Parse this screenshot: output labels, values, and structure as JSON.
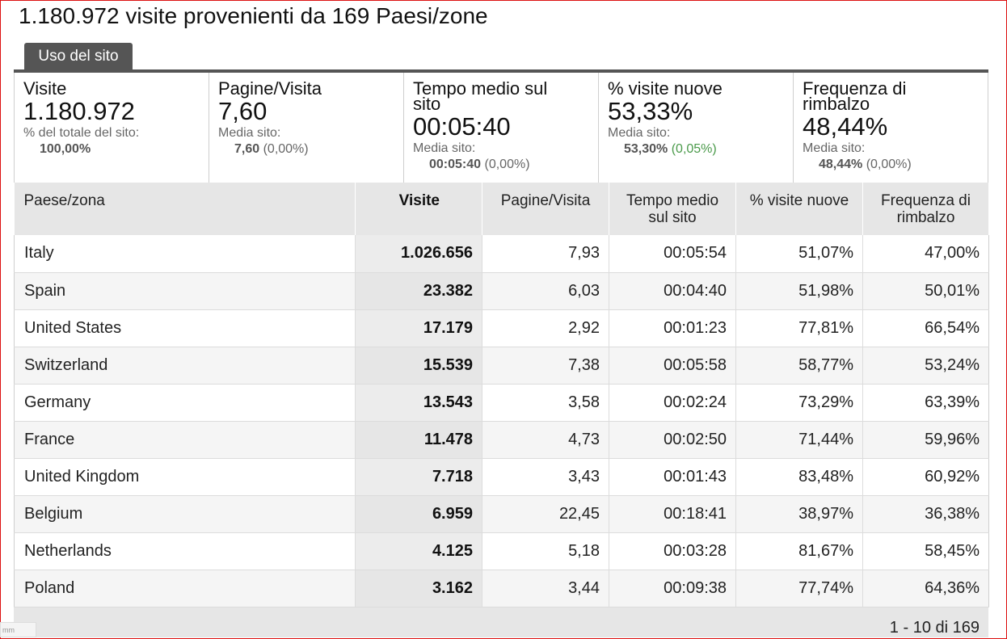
{
  "title": "1.180.972 visite provenienti da 169 Paesi/zone",
  "tab": "Uso del sito",
  "summary": [
    {
      "label": "Visite",
      "value": "1.180.972",
      "sub_label": "% del totale del sito:",
      "sub_value_bold": "100,00%",
      "sub_value_extra": ""
    },
    {
      "label": "Pagine/Visita",
      "value": "7,60",
      "sub_label": "Media sito:",
      "sub_value_bold": "7,60",
      "sub_value_extra": " (0,00%)"
    },
    {
      "label": "Tempo medio sul sito",
      "value": "00:05:40",
      "sub_label": "Media sito:",
      "sub_value_bold": "00:05:40",
      "sub_value_extra": " (0,00%)"
    },
    {
      "label": "% visite nuove",
      "value": "53,33%",
      "sub_label": "Media sito:",
      "sub_value_bold": "53,30%",
      "sub_value_extra": " (0,05%)"
    },
    {
      "label": "Frequenza di rimbalzo",
      "value": "48,44%",
      "sub_label": "Media sito:",
      "sub_value_bold": "48,44%",
      "sub_value_extra": " (0,00%)"
    }
  ],
  "table": {
    "headers": [
      "Paese/zona",
      "Visite",
      "Pagine/Visita",
      "Tempo medio sul sito",
      "% visite nuove",
      "Frequenza di rimbalzo"
    ],
    "rows": [
      [
        "Italy",
        "1.026.656",
        "7,93",
        "00:05:54",
        "51,07%",
        "47,00%"
      ],
      [
        "Spain",
        "23.382",
        "6,03",
        "00:04:40",
        "51,98%",
        "50,01%"
      ],
      [
        "United States",
        "17.179",
        "2,92",
        "00:01:23",
        "77,81%",
        "66,54%"
      ],
      [
        "Switzerland",
        "15.539",
        "7,38",
        "00:05:58",
        "58,77%",
        "53,24%"
      ],
      [
        "Germany",
        "13.543",
        "3,58",
        "00:02:24",
        "73,29%",
        "63,39%"
      ],
      [
        "France",
        "11.478",
        "4,73",
        "00:02:50",
        "71,44%",
        "59,96%"
      ],
      [
        "United Kingdom",
        "7.718",
        "3,43",
        "00:01:43",
        "83,48%",
        "60,92%"
      ],
      [
        "Belgium",
        "6.959",
        "22,45",
        "00:18:41",
        "38,97%",
        "36,38%"
      ],
      [
        "Netherlands",
        "4.125",
        "5,18",
        "00:03:28",
        "81,67%",
        "58,45%"
      ],
      [
        "Poland",
        "3.162",
        "3,44",
        "00:09:38",
        "77,74%",
        "64,36%"
      ]
    ]
  },
  "pager": "1 - 10 di 169",
  "corner_text": "mm",
  "colors": {
    "accent_bar": "#555555",
    "positive_change": "#4a9a4a",
    "frame": "#dd1111"
  }
}
